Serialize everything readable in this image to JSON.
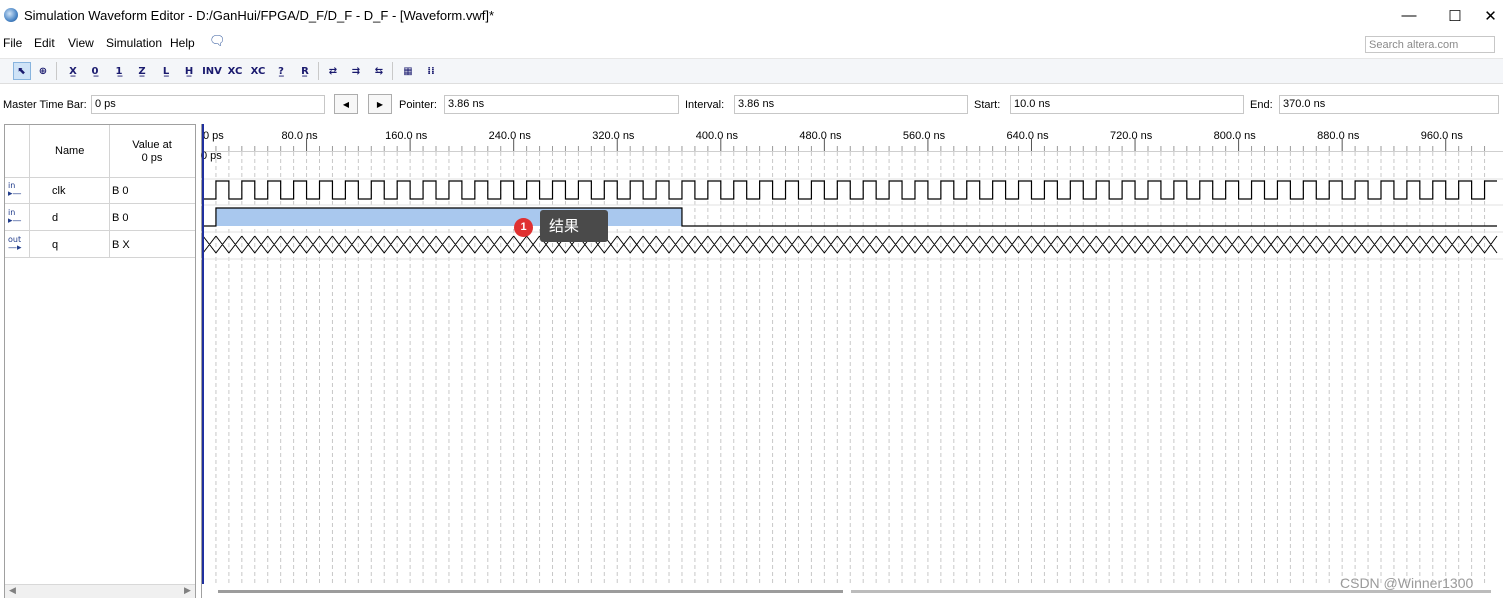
{
  "window": {
    "title": "Simulation Waveform Editor - D:/GanHui/FPGA/D_F/D_F - D_F - [Waveform.vwf]*",
    "minimize": "—",
    "maximize": "☐",
    "close": "✕"
  },
  "menu": {
    "items": [
      "File",
      "Edit",
      "View",
      "Simulation",
      "Help"
    ],
    "search_placeholder": "Search altera.com"
  },
  "toolbar": {
    "icons": [
      "select-icon",
      "zoom-icon",
      "forcing-unknown-icon",
      "forcing-low-icon",
      "forcing-high-icon",
      "forcing-high-impedance-icon",
      "weak-low-icon",
      "weak-high-icon",
      "invert-icon",
      "count-value-icon",
      "overwrite-clock-icon",
      "random-values-icon",
      "arbitrary-value-icon",
      "simulation-run-icon",
      "functional-sim-icon",
      "timing-sim-icon",
      "snap-to-grid-icon",
      "grid-icon"
    ],
    "glyphs": [
      "⬉",
      "⊕",
      "X̲",
      "0̲",
      "1̲",
      "Z̲",
      "L̲",
      "H̲",
      "INV",
      "XC",
      "XC",
      "?̲",
      "R̲",
      "⇄",
      "⇉",
      "⇆",
      "▦",
      "⁞⁞"
    ]
  },
  "timebar": {
    "master_label": "Master Time Bar:",
    "master_value": "0 ps",
    "pointer_label": "Pointer:",
    "pointer_value": "3.86 ns",
    "interval_label": "Interval:",
    "interval_value": "3.86 ns",
    "start_label": "Start:",
    "start_value": "10.0 ns",
    "end_label": "End:",
    "end_value": "370.0 ns",
    "prev_glyph": "◀",
    "next_glyph": "▶"
  },
  "signal_table": {
    "name_header": "Name",
    "value_header_line1": "Value at",
    "value_header_line2": "0 ps",
    "signals": [
      {
        "dir": "in",
        "name": "clk",
        "value": "B 0"
      },
      {
        "dir": "in",
        "name": "d",
        "value": "B 0"
      },
      {
        "dir": "out",
        "name": "q",
        "value": "B X"
      }
    ]
  },
  "ruler": {
    "ticks": [
      "0 ps",
      "80.0 ns",
      "160.0 ns",
      "240.0 ns",
      "320.0 ns",
      "400.0 ns",
      "480.0 ns",
      "560.0 ns",
      "640.0 ns",
      "720.0 ns",
      "800.0 ns",
      "880.0 ns",
      "960.0 ns"
    ],
    "cursor_label": "0 ps"
  },
  "waveforms": {
    "time_range_ns": [
      0,
      1000
    ],
    "clk_period_ns": 20,
    "d_high_interval_ns": [
      10,
      370
    ],
    "q_state": "unknown"
  },
  "annotation": {
    "badge": "1",
    "text": "结果"
  },
  "watermark": "CSDN @Winner1300",
  "colors": {
    "d_fill": "#a9c8ee",
    "cursor": "#1f2f9e",
    "tooltip_bg": "#4a4a4a",
    "badge": "#e03131"
  }
}
